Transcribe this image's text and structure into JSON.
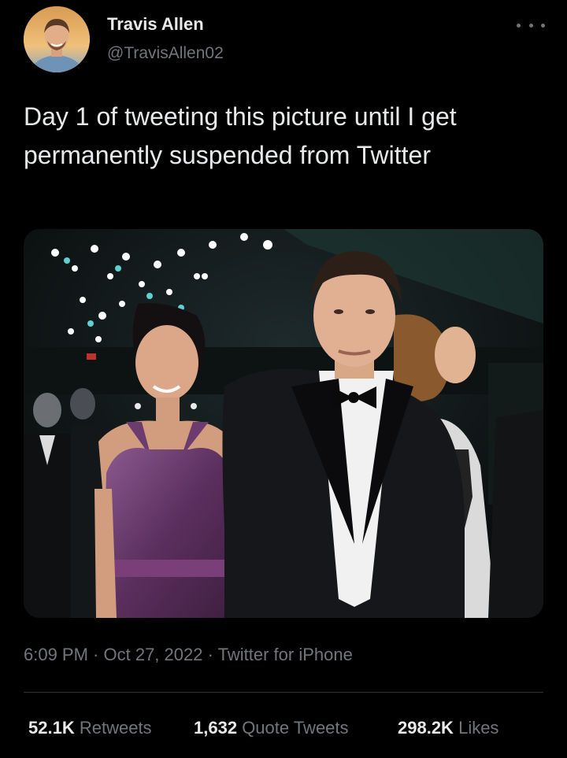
{
  "tweet": {
    "author": {
      "name": "Travis Allen",
      "handle": "@TravisAllen02"
    },
    "text": "Day 1 of tweeting this picture until I get permanently suspended from Twitter",
    "time": "6:09 PM",
    "date": "Oct 27, 2022",
    "sep": " · ",
    "source": "Twitter for iPhone",
    "stats": {
      "retweets": {
        "count": "52.1K",
        "label": "Retweets"
      },
      "quotes": {
        "count": "1,632",
        "label": "Quote Tweets"
      },
      "likes": {
        "count": "298.2K",
        "label": "Likes"
      }
    }
  },
  "icons": {
    "more": "more-horizontal-icon"
  },
  "colors": {
    "background": "#000000",
    "text": "#e7e9ea",
    "secondary": "#71767b",
    "divider": "#2f3336"
  }
}
